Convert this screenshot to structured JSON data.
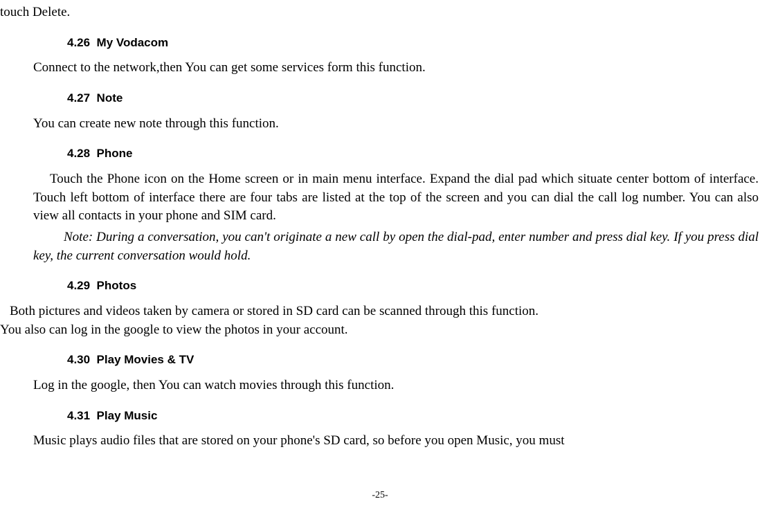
{
  "fragment_top": "touch Delete.",
  "sections": [
    {
      "num": "4.26",
      "title": "My Vodacom",
      "body": "Connect to the network,then You can get some services form this function."
    },
    {
      "num": "4.27",
      "title": "Note",
      "body": "You can create new note through this function."
    },
    {
      "num": "4.28",
      "title": "Phone",
      "body_indent": "Touch the Phone icon on the Home screen or in main menu interface. Expand the dial pad which situate center bottom of interface. Touch left bottom of interface there are four tabs are listed at the top of the screen and you can dial the call log number. You can also view all contacts in your phone and SIM card.",
      "note": "Note: During a conversation, you can't originate a new call by open the dial-pad, enter number and press dial key. If you press dial key, the current conversation would hold."
    },
    {
      "num": "4.29",
      "title": "Photos",
      "flush1": "Both pictures and videos taken by camera or stored in SD card can be scanned through this function.",
      "flush2": "You also can log in the google to view the photos in your account."
    },
    {
      "num": "4.30",
      "title": "Play Movies & TV",
      "body": "Log in the google, then You can watch movies through this function."
    },
    {
      "num": "4.31",
      "title": "Play Music",
      "body": "Music plays audio files that are stored on your phone's SD card, so before you open Music, you must"
    }
  ],
  "page_number": "-25-"
}
